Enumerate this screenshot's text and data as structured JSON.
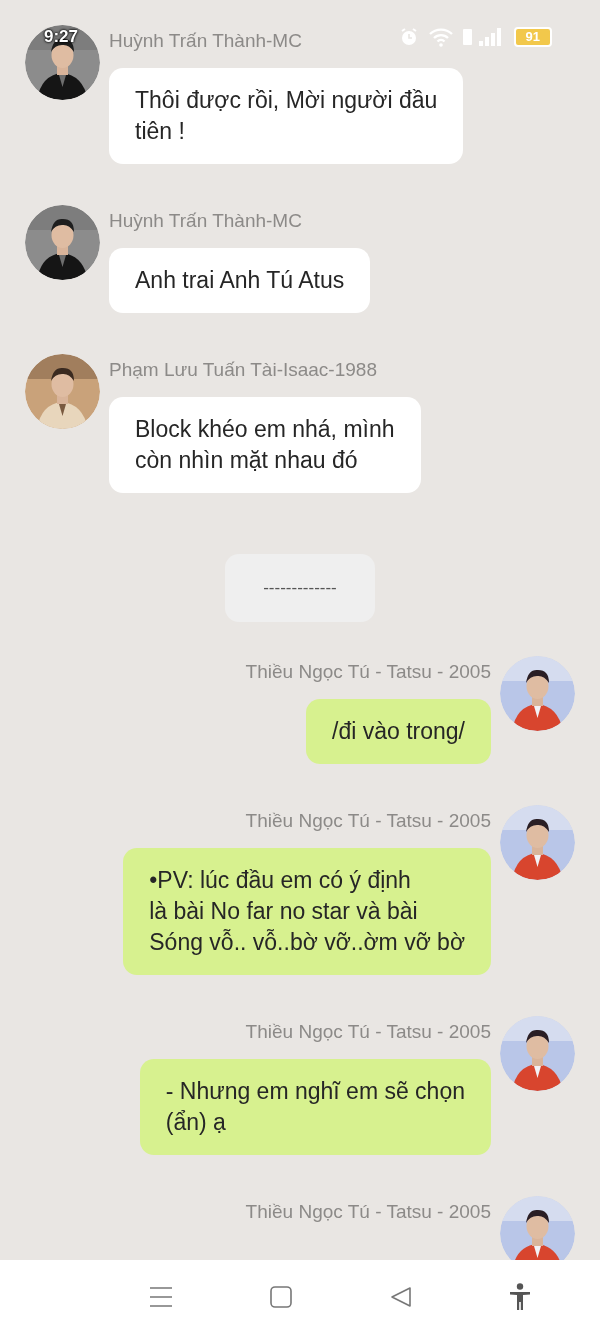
{
  "status_bar": {
    "time": "9:27",
    "battery": "91"
  },
  "messages": [
    {
      "kind": "incoming",
      "sender": "Huỳnh Trấn Thành-MC",
      "text": "Thôi được rồi, Mời người đầu\ntiên !"
    },
    {
      "kind": "incoming",
      "sender": "Huỳnh Trấn Thành-MC",
      "text": "Anh trai Anh Tú Atus"
    },
    {
      "kind": "incoming",
      "sender": "Phạm Lưu Tuấn Tài-Isaac-1988",
      "text": "Block khéo em nhá, mình\ncòn nhìn mặt nhau đó"
    },
    {
      "kind": "divider",
      "text": "-------------"
    },
    {
      "kind": "outgoing",
      "sender": "Thiều Ngọc Tú - Tatsu - 2005",
      "text": "/đi vào trong/"
    },
    {
      "kind": "outgoing",
      "sender": "Thiều Ngọc Tú - Tatsu - 2005",
      "text": "•PV: lúc đầu em có ý định\nlà bài No far no star và bài\nSóng vỗ.. vỗ..bờ vỡ..ờm vỡ bờ"
    },
    {
      "kind": "outgoing",
      "sender": "Thiều Ngọc Tú - Tatsu - 2005",
      "text": "- Nhưng em nghĩ em sẽ chọn\n(ẩn) ạ"
    },
    {
      "kind": "outgoing",
      "sender": "Thiều Ngọc Tú - Tatsu - 2005"
    }
  ]
}
